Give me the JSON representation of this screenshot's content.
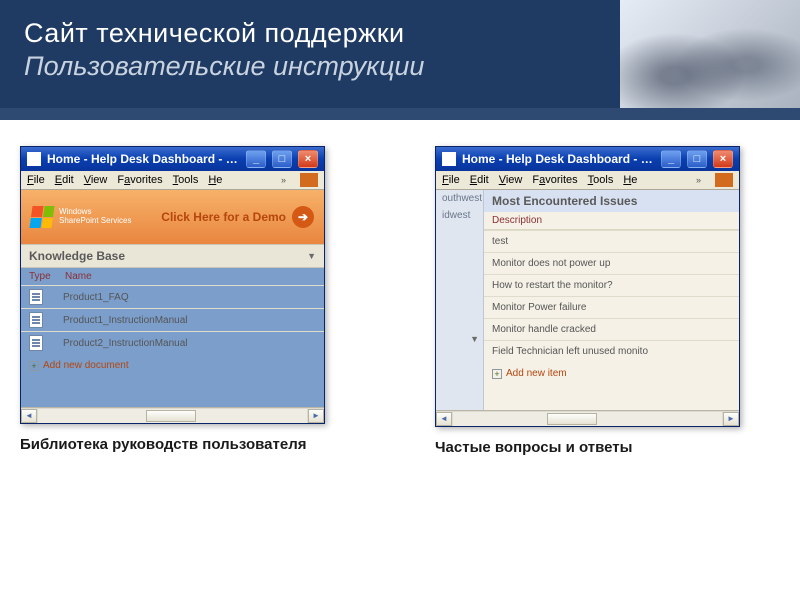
{
  "slide": {
    "title": "Сайт технической поддержки",
    "subtitle": "Пользовательские инструкции"
  },
  "windows": {
    "left": {
      "title": "Home - Help Desk Dashboard - …",
      "menu": [
        "File",
        "Edit",
        "View",
        "Favorites",
        "Tools",
        "He"
      ],
      "banner_brand1": "Windows",
      "banner_brand2": "SharePoint Services",
      "banner_cta": "Click Here for a Demo",
      "kb_header": "Knowledge Base",
      "kb_cols": {
        "c1": "Type",
        "c2": "Name"
      },
      "kb_rows": [
        "Product1_FAQ",
        "Product1_InstructionManual",
        "Product2_InstructionManual"
      ],
      "add_label": "Add new document",
      "caption": "Библиотека руководств пользователя"
    },
    "right": {
      "title": "Home - Help Desk Dashboard - …",
      "menu": [
        "File",
        "Edit",
        "View",
        "Favorites",
        "Tools",
        "He"
      ],
      "regions": [
        "outhwest",
        "idwest"
      ],
      "issues_header": "Most Encountered Issues",
      "issues_col": "Description",
      "issues": [
        "test",
        "Monitor does not power up",
        "How to restart the monitor?",
        "Monitor Power failure",
        "Monitor handle cracked",
        "Field Technician left unused monito"
      ],
      "add_label": "Add new item",
      "caption": "Частые вопросы и ответы"
    }
  }
}
